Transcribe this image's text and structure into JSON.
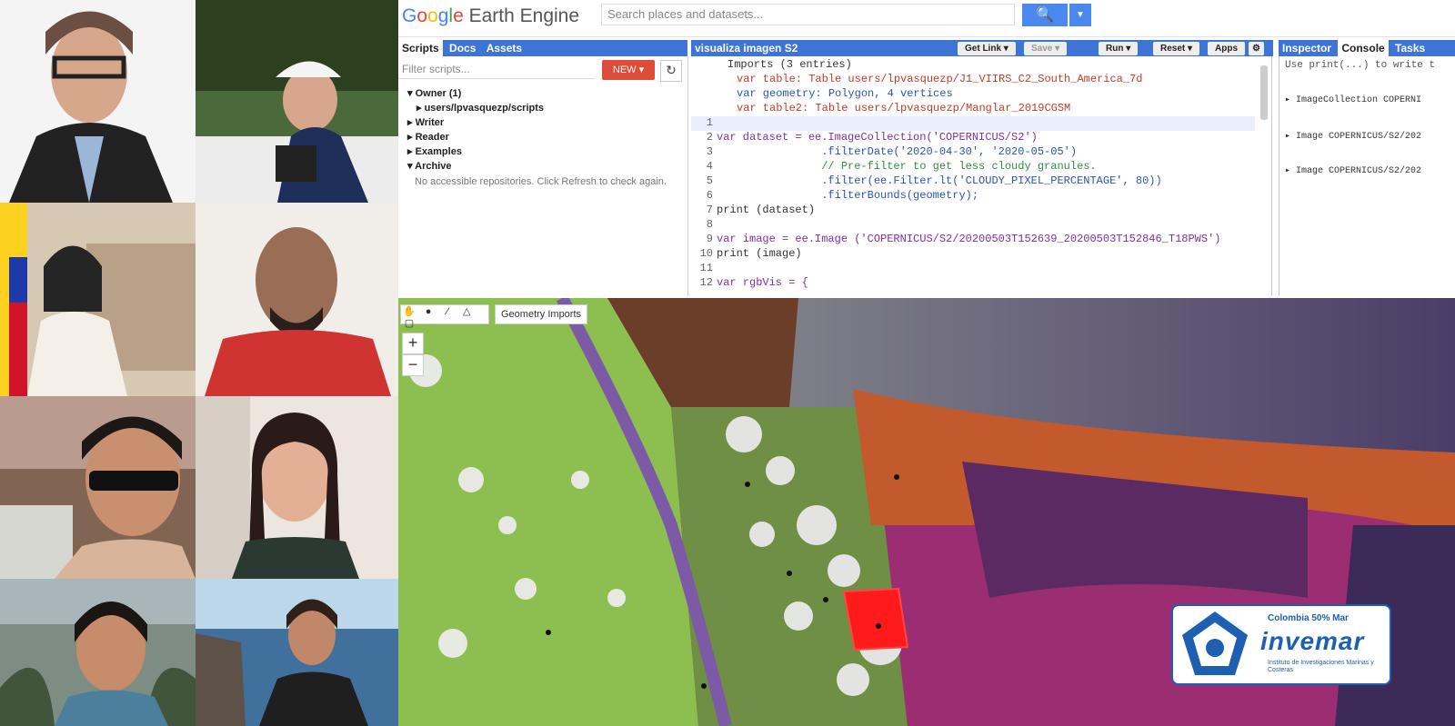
{
  "gallery": {
    "photos": [
      {
        "name": "person-1"
      },
      {
        "name": "person-2"
      },
      {
        "name": "person-3"
      },
      {
        "name": "person-4"
      },
      {
        "name": "person-5"
      },
      {
        "name": "person-6"
      },
      {
        "name": "person-7"
      },
      {
        "name": "person-8"
      }
    ]
  },
  "app": {
    "brand": "Google Earth Engine",
    "search_placeholder": "Search places and datasets..."
  },
  "left_panel": {
    "tabs": [
      "Scripts",
      "Docs",
      "Assets"
    ],
    "filter_placeholder": "Filter scripts...",
    "new_button": "NEW",
    "tree": [
      {
        "label": "Owner (1)",
        "expanded": true
      },
      {
        "label": "users/lpvasquezp/scripts",
        "expanded": false
      },
      {
        "label": "Writer",
        "expanded": false
      },
      {
        "label": "Reader",
        "expanded": false
      },
      {
        "label": "Examples",
        "expanded": false
      },
      {
        "label": "Archive",
        "expanded": true
      }
    ],
    "archive_note": "No accessible repositories. Click Refresh to check again."
  },
  "editor": {
    "title": "visualiza imagen S2",
    "buttons": [
      "Get Link",
      "Save",
      "Run",
      "Reset",
      "Apps"
    ],
    "imports": [
      "Imports (3 entries)",
      "var table: Table users/lpvasquezp/J1_VIIRS_C2_South_America_7d",
      "var geometry: Polygon, 4 vertices",
      "var table2: Table users/lpvasquezp/Manglar_2019CGSM"
    ],
    "lines": [
      {
        "n": "1",
        "text": ""
      },
      {
        "n": "2",
        "text": "var dataset = ee.ImageCollection('COPERNICUS/S2')"
      },
      {
        "n": "3",
        "text": "                .filterDate('2020-04-30', '2020-05-05')"
      },
      {
        "n": "4",
        "text": "                // Pre-filter to get less cloudy granules."
      },
      {
        "n": "5",
        "text": "                .filter(ee.Filter.lt('CLOUDY_PIXEL_PERCENTAGE', 80))"
      },
      {
        "n": "6",
        "text": "                .filterBounds(geometry);"
      },
      {
        "n": "7",
        "text": "print (dataset)"
      },
      {
        "n": "8",
        "text": ""
      },
      {
        "n": "9",
        "text": "var image = ee.Image ('COPERNICUS/S2/20200503T152639_20200503T152846_T18PWS')"
      },
      {
        "n": "10",
        "text": "print (image)"
      },
      {
        "n": "11",
        "text": ""
      },
      {
        "n": "12",
        "text": "var rgbVis = {"
      }
    ]
  },
  "right_panel": {
    "tabs": [
      "Inspector",
      "Console",
      "Tasks"
    ],
    "console_hint": "Use print(...) to write t",
    "entries": [
      "ImageCollection COPERNI",
      "Image COPERNICUS/S2/202",
      "Image COPERNICUS/S2/202"
    ]
  },
  "map": {
    "geometry_imports_label": "Geometry Imports",
    "zoom_in": "+",
    "zoom_out": "−"
  },
  "watermark": {
    "small_text": "Colombia 50% Mar",
    "title": "invemar",
    "subtitle": "Instituto de Investigaciones Marinas y Costeras"
  }
}
